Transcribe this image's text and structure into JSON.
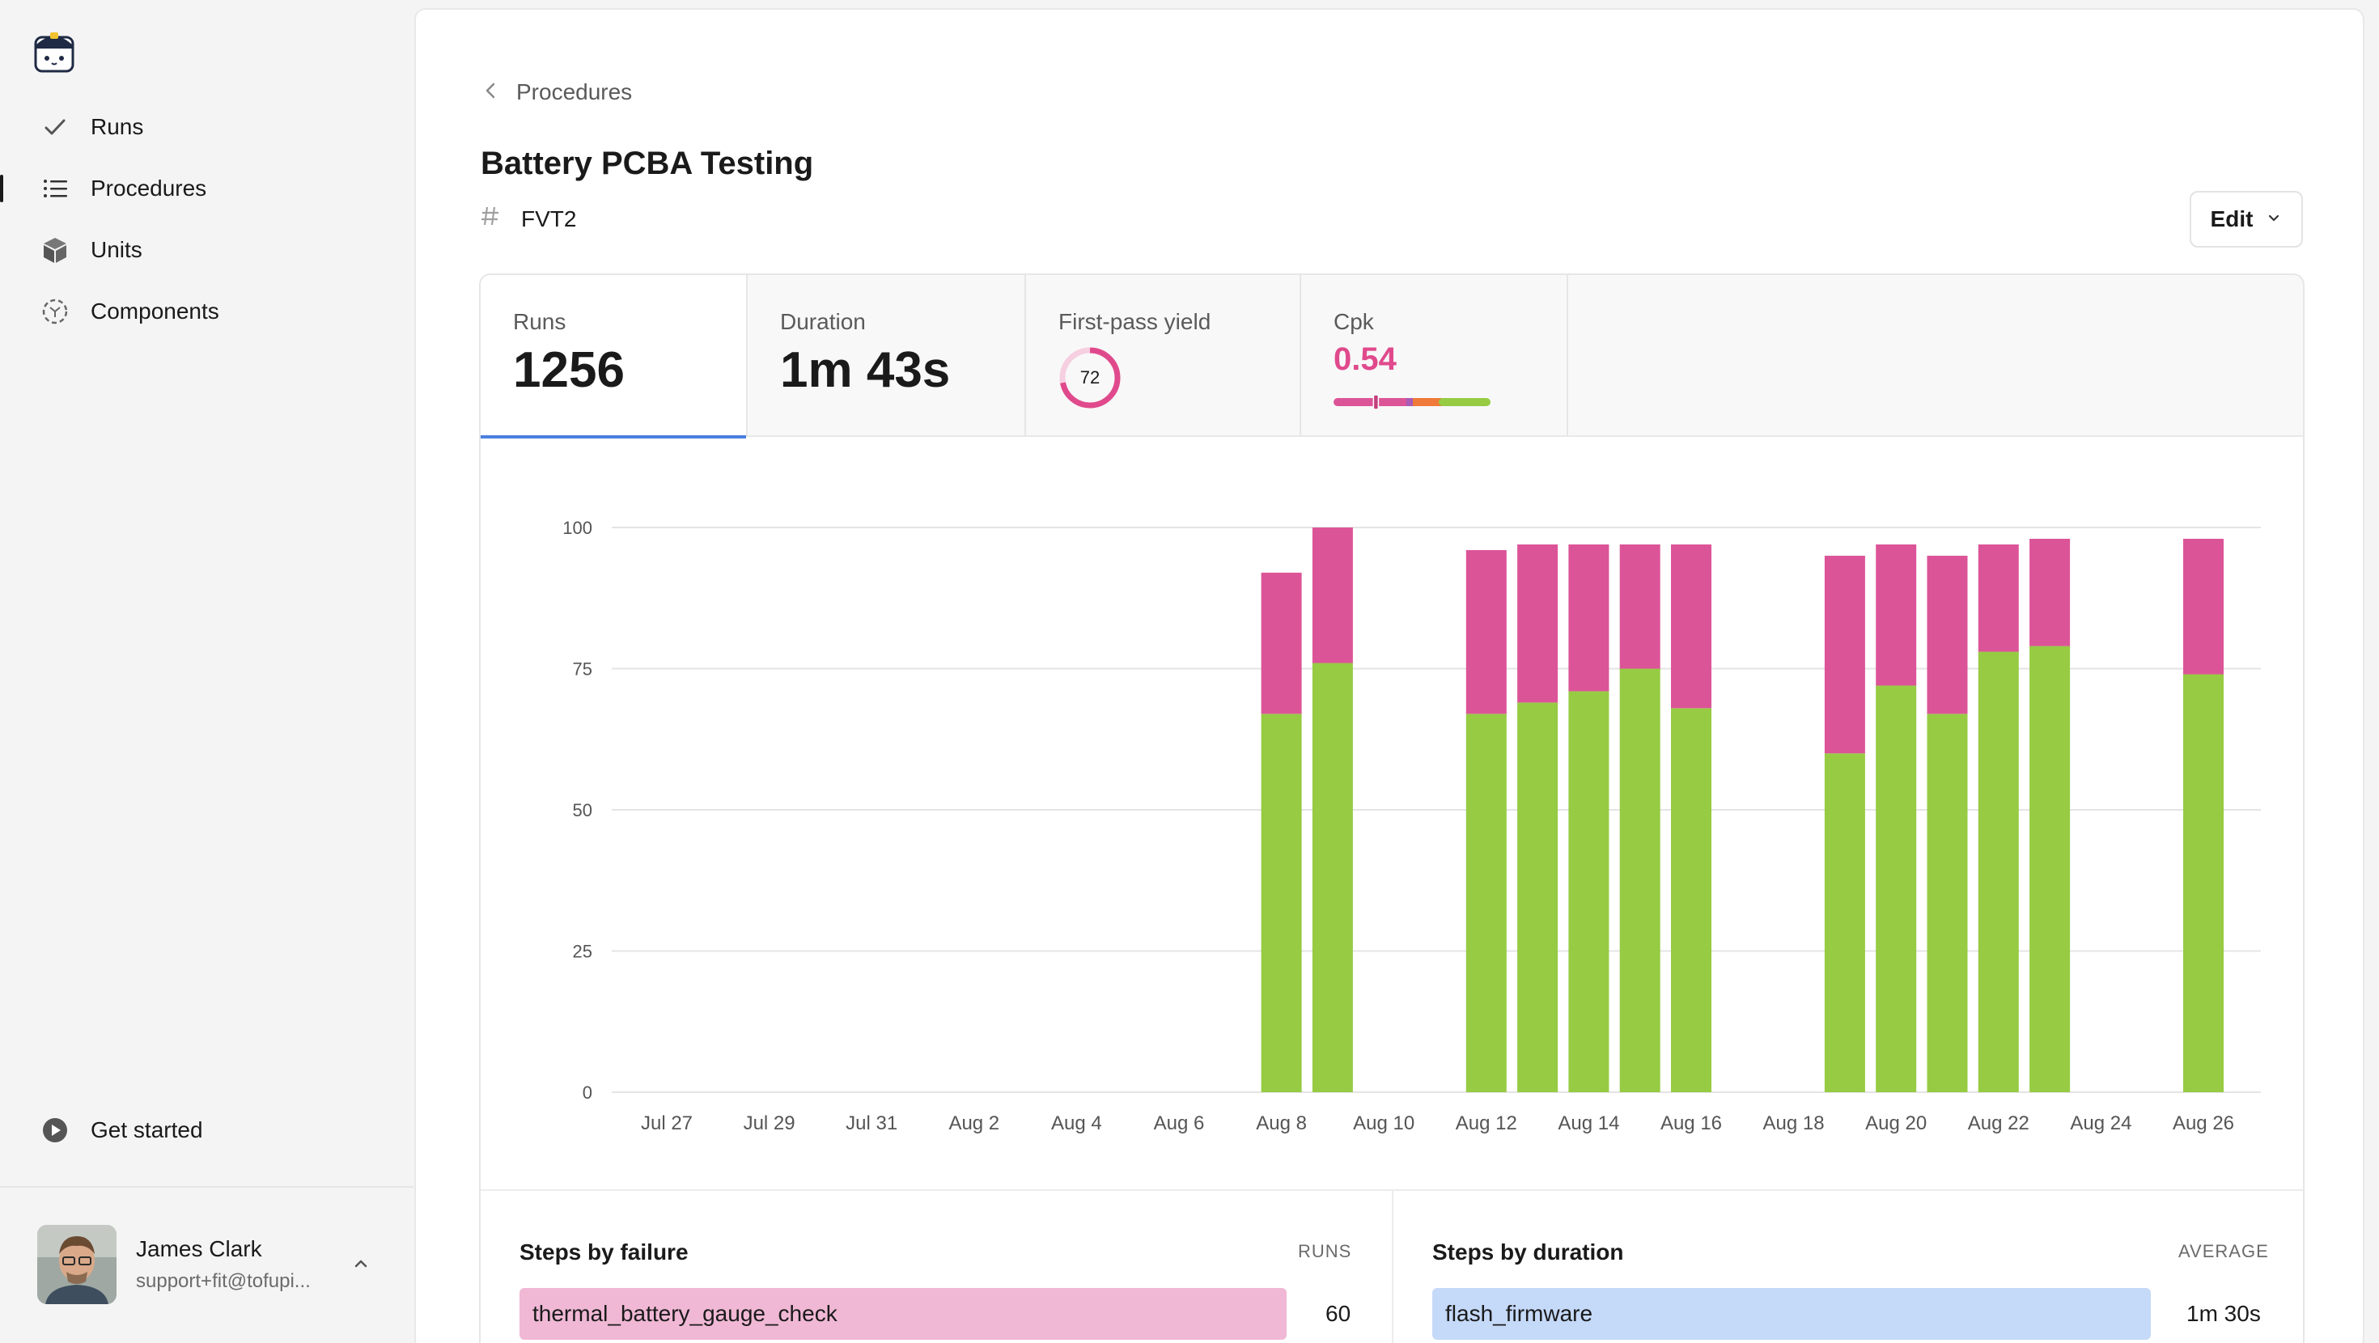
{
  "sidebar": {
    "items": [
      {
        "label": "Runs",
        "icon": "check-icon"
      },
      {
        "label": "Procedures",
        "icon": "list-icon"
      },
      {
        "label": "Units",
        "icon": "cube-icon"
      },
      {
        "label": "Components",
        "icon": "component-icon"
      }
    ],
    "get_started": "Get started",
    "user": {
      "name": "James Clark",
      "email": "support+fit@tofupi..."
    }
  },
  "breadcrumb": {
    "label": "Procedures"
  },
  "page": {
    "title": "Battery PCBA Testing",
    "tag": "FVT2"
  },
  "edit_button": {
    "label": "Edit"
  },
  "stats": {
    "runs": {
      "label": "Runs",
      "value": "1256"
    },
    "duration": {
      "label": "Duration",
      "value": "1m 43s"
    },
    "yield": {
      "label": "First-pass yield",
      "value": 72
    },
    "cpk": {
      "label": "Cpk",
      "value": "0.54",
      "marker": 0.27
    }
  },
  "colors": {
    "pass": "#96cb43",
    "fail": "#dc5498",
    "accent": "#4a7fe0"
  },
  "chart_data": {
    "type": "bar",
    "stacked": true,
    "ylim": [
      0,
      100
    ],
    "yticks": [
      0,
      25,
      50,
      75,
      100
    ],
    "grid": true,
    "x_tick_labels": [
      "Jul 27",
      "Jul 29",
      "Jul 31",
      "Aug 2",
      "Aug 4",
      "Aug 6",
      "Aug 8",
      "Aug 10",
      "Aug 12",
      "Aug 14",
      "Aug 16",
      "Aug 18",
      "Aug 20",
      "Aug 22",
      "Aug 24",
      "Aug 26"
    ],
    "categories": [
      "Jul 27",
      "Jul 28",
      "Jul 29",
      "Jul 30",
      "Jul 31",
      "Aug 1",
      "Aug 2",
      "Aug 3",
      "Aug 4",
      "Aug 5",
      "Aug 6",
      "Aug 7",
      "Aug 8",
      "Aug 9",
      "Aug 10",
      "Aug 11",
      "Aug 12",
      "Aug 13",
      "Aug 14",
      "Aug 15",
      "Aug 16",
      "Aug 17",
      "Aug 18",
      "Aug 19",
      "Aug 20",
      "Aug 21",
      "Aug 22",
      "Aug 23",
      "Aug 24",
      "Aug 25",
      "Aug 26"
    ],
    "series": [
      {
        "values": [
          0,
          0,
          0,
          0,
          0,
          0,
          0,
          0,
          0,
          0,
          0,
          0,
          67,
          76,
          0,
          0,
          67,
          69,
          71,
          75,
          68,
          0,
          0,
          60,
          72,
          67,
          78,
          79,
          0,
          0,
          74
        ]
      },
      {
        "values": [
          0,
          0,
          0,
          0,
          0,
          0,
          0,
          0,
          0,
          0,
          0,
          0,
          25,
          24,
          0,
          0,
          29,
          28,
          26,
          22,
          29,
          0,
          0,
          35,
          25,
          28,
          19,
          19,
          0,
          0,
          24
        ]
      }
    ]
  },
  "steps_by_failure": {
    "title": "Steps by failure",
    "column": "RUNS",
    "rows": [
      {
        "name": "thermal_battery_gauge_check",
        "value": "60"
      }
    ]
  },
  "steps_by_duration": {
    "title": "Steps by duration",
    "column": "AVERAGE",
    "rows": [
      {
        "name": "flash_firmware",
        "value": "1m 30s"
      }
    ]
  }
}
